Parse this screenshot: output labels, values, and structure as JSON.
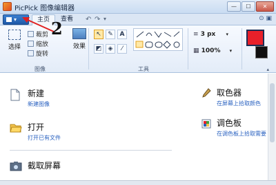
{
  "window": {
    "title": "PicPick 图像编辑器",
    "buttons": {
      "minimize": "—",
      "maximize": "☐",
      "close": "✕"
    }
  },
  "tabs": {
    "file_menu": "▾",
    "items": [
      {
        "label": "主页",
        "active": true
      },
      {
        "label": "查看",
        "active": false
      }
    ],
    "quick_access": {
      "undo": "↶",
      "redo": "↷",
      "more": "▾"
    },
    "help": "⊙ ▣"
  },
  "ribbon": {
    "image_group": {
      "label": "图像",
      "select_label": "选择",
      "crop_label": "裁剪",
      "resize_label": "缩放",
      "rotate_label": "旋转",
      "effect_label": "效果"
    },
    "tools_group": {
      "label": "工具",
      "icons": [
        "pointer-icon",
        "pencil-icon",
        "text-icon",
        "eraser-icon",
        "fill-icon",
        "eyedropper-icon"
      ]
    },
    "line_size": "3 px",
    "opacity": "100%",
    "colors": {
      "primary": "#e8202a",
      "secondary": "#101010"
    }
  },
  "annotation": {
    "number": "2"
  },
  "main": {
    "items": [
      {
        "title": "新建",
        "subtitle": "新建图像",
        "icon": "new-page-icon"
      },
      {
        "title": "打开",
        "subtitle": "打开已有文件",
        "icon": "open-folder-icon"
      },
      {
        "title": "截取屏幕",
        "icon": "screen-capture-icon"
      },
      {
        "title": "取色器",
        "subtitle": "在屏幕上拾取颜色",
        "icon": "color-picker-icon"
      },
      {
        "title": "调色板",
        "subtitle": "在调色板上拾取需要",
        "icon": "color-palette-icon"
      }
    ]
  }
}
